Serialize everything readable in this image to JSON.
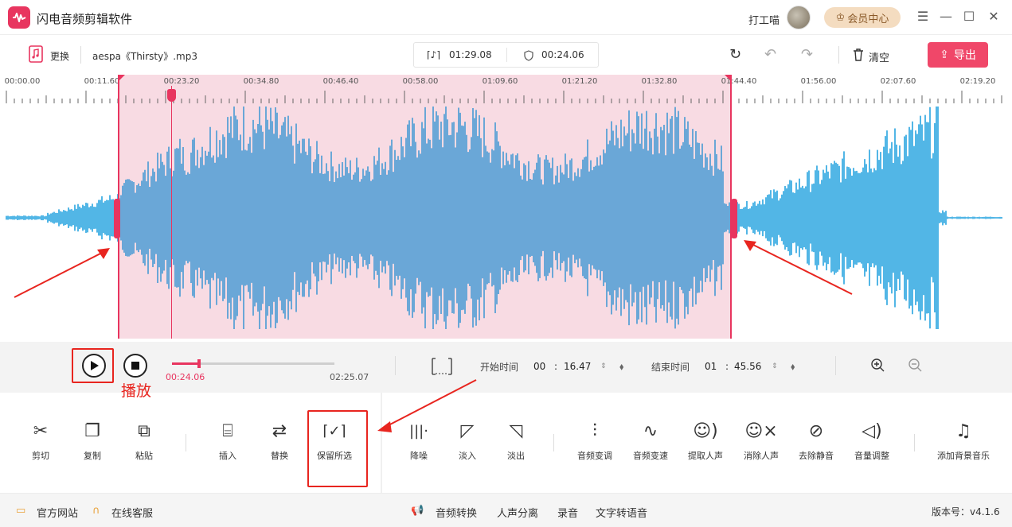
{
  "app": {
    "title": "闪电音频剪辑软件",
    "username": "打工喵",
    "vip_label": "会员中心",
    "window_buttons": [
      "☰",
      "—",
      "☐",
      "✕"
    ]
  },
  "toolbar": {
    "replace_label": "更换",
    "filename": "aespa《Thirsty》.mp3",
    "total_duration": "01:29.08",
    "selection_duration": "00:24.06",
    "clear_label": "清空",
    "export_label": "导出"
  },
  "ruler": {
    "labels": [
      "00:00.00",
      "00:11.60",
      "00:23.20",
      "00:34.80",
      "00:46.40",
      "00:58.00",
      "01:09.60",
      "01:21.20",
      "01:32.80",
      "01:44.40",
      "01:56.00",
      "02:07.60",
      "02:19.20"
    ]
  },
  "waveform": {
    "colors": {
      "selected": "#6aa7d7",
      "unselected": "#52b6e6",
      "selection_bg": "#f6cfda",
      "accent": "#e8355f"
    }
  },
  "transport": {
    "current_time": "00:24.06",
    "total_time": "02:25.07",
    "progress": 0.166,
    "start_label": "开始时间",
    "start_min": "00",
    "start_sec": "16.47",
    "end_label": "结束时间",
    "end_min": "01",
    "end_sec": "45.56"
  },
  "annotations": {
    "play_label": "播放",
    "color": "#e8251f"
  },
  "tools": {
    "cut": "剪切",
    "copy": "复制",
    "paste": "粘贴",
    "insert": "插入",
    "replace": "替换",
    "keep_selected": "保留所选",
    "denoise": "降噪",
    "fade_in": "淡入",
    "fade_out": "淡出",
    "pitch": "音频变调",
    "speed": "音频变速",
    "extract_vocal": "提取人声",
    "remove_vocal": "消除人声",
    "remove_silence": "去除静音",
    "volume": "音量调整",
    "add_bgm": "添加背景音乐"
  },
  "statusbar": {
    "website": "官方网站",
    "support": "在线客服",
    "convert": "音频转换",
    "vocal_separation": "人声分离",
    "record": "录音",
    "tts": "文字转语音",
    "version": "版本号：v4.1.6"
  }
}
